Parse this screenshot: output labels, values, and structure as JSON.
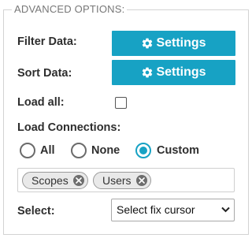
{
  "section": {
    "legend": "ADVANCED OPTIONS:"
  },
  "filter": {
    "label": "Filter Data:",
    "button": "Settings",
    "icon": "gear-icon"
  },
  "sort": {
    "label": "Sort Data:",
    "button": "Settings",
    "icon": "gear-icon"
  },
  "load_all": {
    "label": "Load all:",
    "checked": false
  },
  "connections": {
    "label": "Load Connections:",
    "options": [
      "All",
      "None",
      "Custom"
    ],
    "selected": "Custom",
    "tags": [
      "Scopes",
      "Users"
    ]
  },
  "select": {
    "label": "Select:",
    "value": "Select fix cursor"
  },
  "colors": {
    "accent": "#17a2c4",
    "tag_bg": "#e9e9e9",
    "border": "#d3d3d3"
  }
}
